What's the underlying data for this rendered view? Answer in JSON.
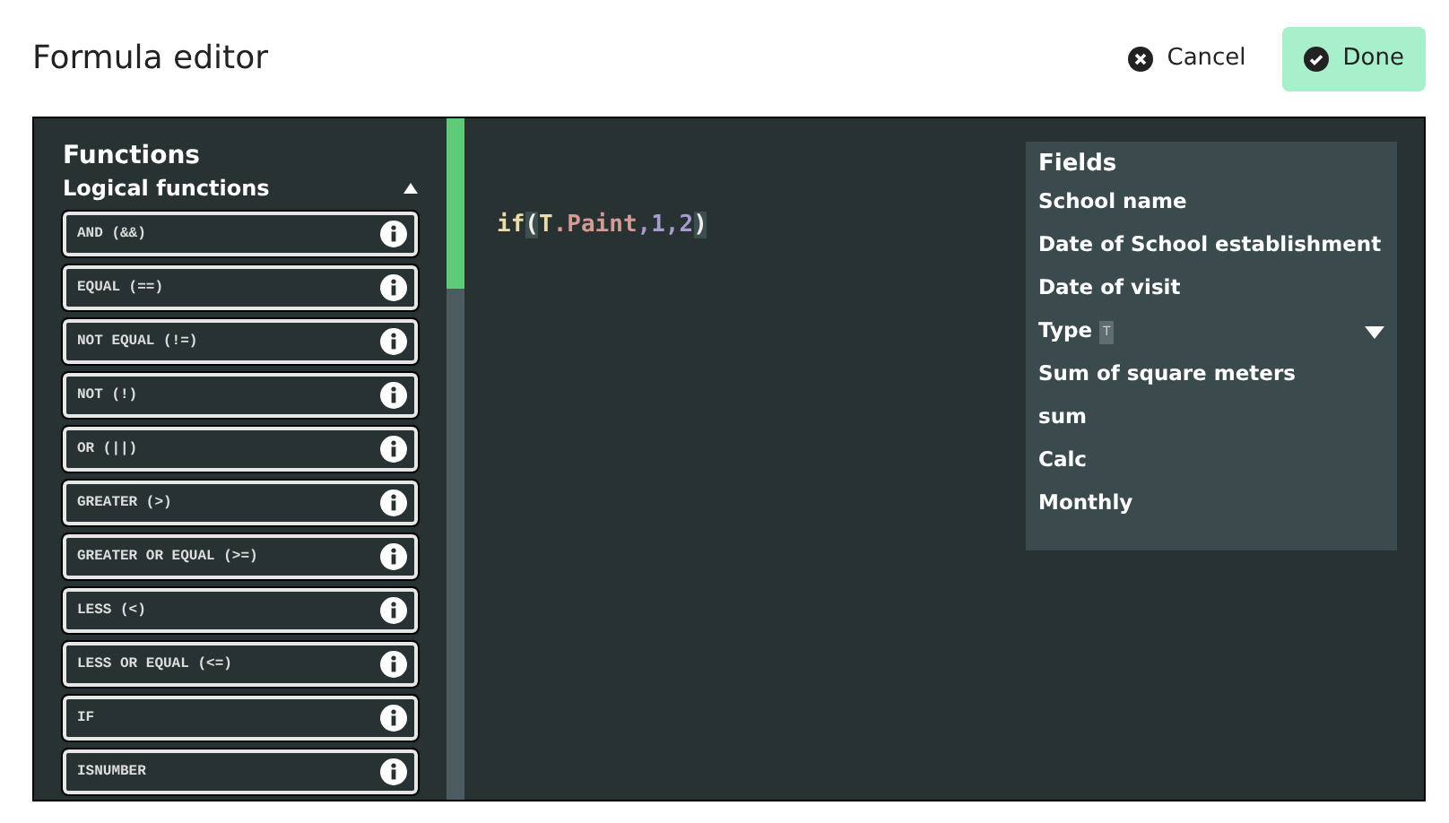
{
  "title": "Formula editor",
  "buttons": [
    {
      "kind": "cancel",
      "label": "Cancel"
    },
    {
      "kind": "done",
      "label": "Done"
    }
  ],
  "functions": {
    "title": "Functions",
    "group": {
      "label": "Logical functions",
      "expanded": true
    },
    "items": [
      "AND (&&)",
      "EQUAL (==)",
      "NOT EQUAL (!=)",
      "NOT (!)",
      "OR (||)",
      "GREATER (>)",
      "GREATER OR EQUAL (>=)",
      "LESS (<)",
      "LESS OR EQUAL (<=)",
      "IF",
      "ISNUMBER"
    ]
  },
  "editor": {
    "tokens": [
      {
        "kind": "keyword",
        "text": "if"
      },
      {
        "kind": "bracket",
        "text": "("
      },
      {
        "kind": "table",
        "text": "T"
      },
      {
        "kind": "field",
        "text": ".Paint"
      },
      {
        "kind": "number",
        "text": ",1,2"
      },
      {
        "kind": "bracket",
        "text": ")"
      }
    ]
  },
  "fields": {
    "title": "Fields",
    "items": [
      {
        "label": "School name"
      },
      {
        "label": "Date of School establishment"
      },
      {
        "label": "Date of visit"
      },
      {
        "label": "Type",
        "badge": "T",
        "expanded": false
      },
      {
        "label": "Sum of square meters"
      },
      {
        "label": "sum"
      },
      {
        "label": "Calc"
      },
      {
        "label": "Monthly"
      }
    ]
  }
}
